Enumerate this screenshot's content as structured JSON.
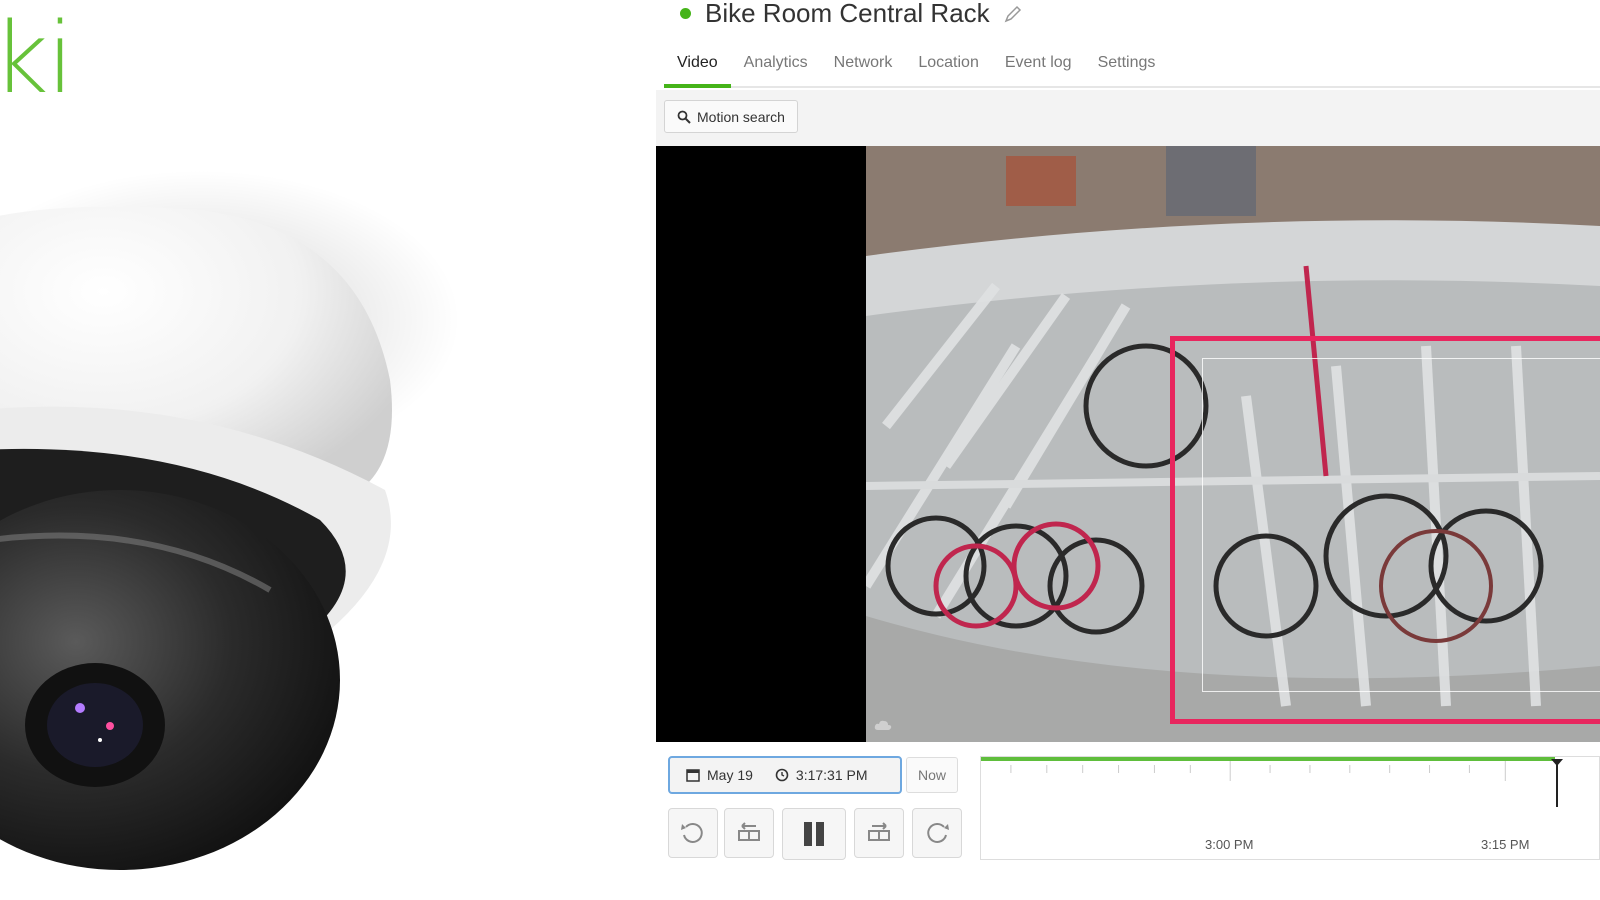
{
  "brand": {
    "text": "ki",
    "color": "#67c23a"
  },
  "camera": {
    "title": "Bike Room Central Rack",
    "status": "online",
    "status_color": "#45b419"
  },
  "tabs": [
    {
      "label": "Video",
      "active": true
    },
    {
      "label": "Analytics",
      "active": false
    },
    {
      "label": "Network",
      "active": false
    },
    {
      "label": "Location",
      "active": false
    },
    {
      "label": "Event log",
      "active": false
    },
    {
      "label": "Settings",
      "active": false
    }
  ],
  "toolbar": {
    "motion_search_label": "Motion search",
    "icon": "search-icon"
  },
  "video": {
    "motion_box_color": "#e8265e",
    "overlay_icon": "cloud-icon"
  },
  "playback": {
    "date": "May 19",
    "time": "3:17:31 PM",
    "now_label": "Now",
    "buttons": [
      "rewind-icon",
      "skip-back-icon",
      "pause-icon",
      "skip-forward-icon",
      "forward-icon"
    ]
  },
  "timeline": {
    "labels": [
      "3:00 PM",
      "3:15 PM"
    ],
    "progress_color": "#5fbe3c"
  }
}
